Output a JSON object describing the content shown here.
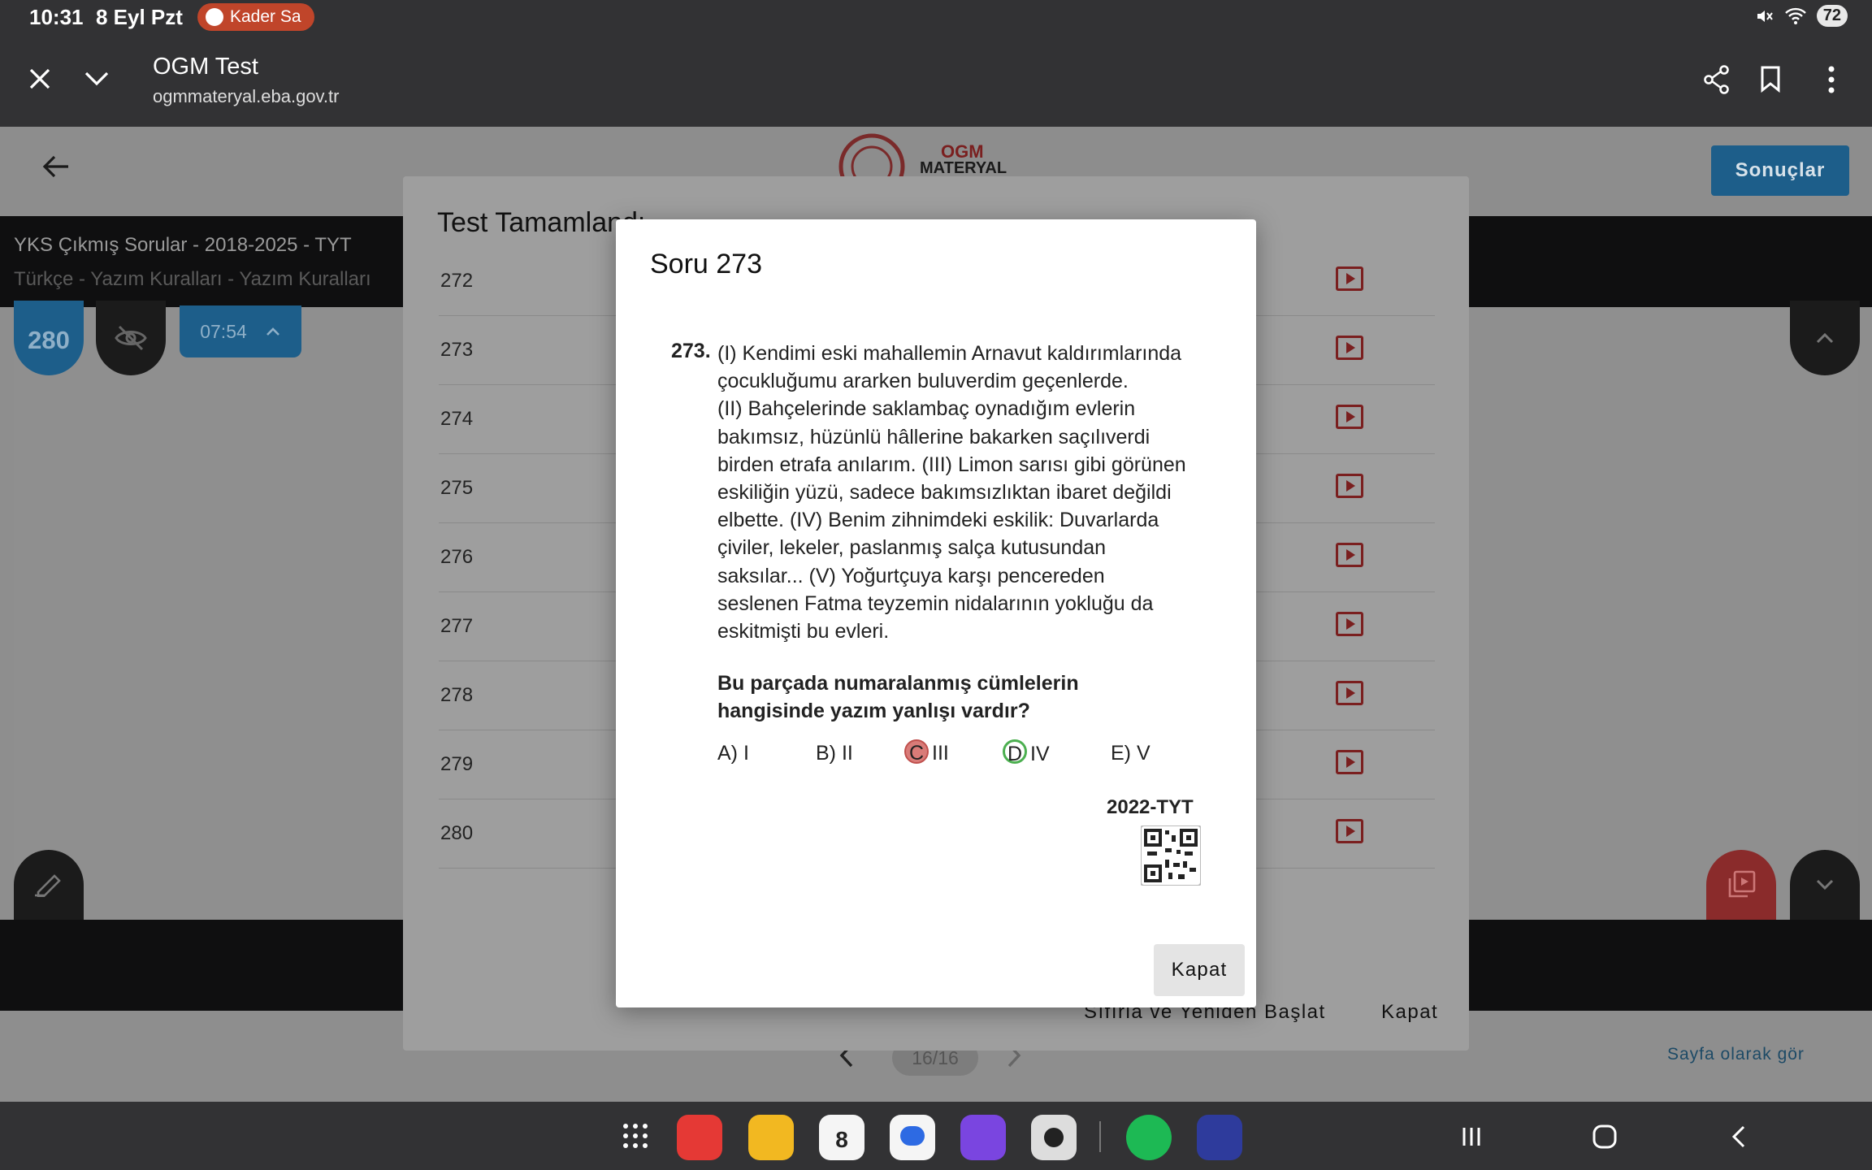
{
  "status": {
    "time": "10:31",
    "date": "8 Eyl Pzt",
    "media_chip": "Kader Sa",
    "battery": "72"
  },
  "browser": {
    "title": "OGM Test",
    "url": "ogmmateryal.eba.gov.tr"
  },
  "app": {
    "logo_text_1": "OGM",
    "logo_text_2": "MATERYAL",
    "results_button": "Sonuçlar",
    "breadcrumb_1": "YKS Çıkmış Sorular - 2018-2025 - TYT",
    "breadcrumb_2": "Türkçe - Yazım Kuralları - Yazım Kuralları",
    "question_badge": "280",
    "timer": "07:54",
    "pager_count": "16/16",
    "page_view_link": "Sayfa olarak gör"
  },
  "results_dialog": {
    "title": "Test Tamamlandı",
    "rows": [
      "272",
      "273",
      "274",
      "275",
      "276",
      "277",
      "278",
      "279",
      "280"
    ],
    "reset_button": "Sıfırla ve Yeniden Başlat",
    "close_button": "Kapat"
  },
  "question_modal": {
    "title": "Soru 273",
    "number": "273.",
    "passage": "(I) Kendimi eski mahallemin Arnavut kaldırımlarında\nçocukluğumu ararken buluverdim geçenlerde.\n(II) Bahçelerinde saklambaç oynadığım evlerin\nbakımsız, hüzünlü hâllerine bakarken saçılıverdi\nbirden etrafa anılarım. (III) Limon sarısı gibi görünen\neskiliğin yüzü, sadece bakımsızlıktan ibaret değildi\nelbette. (IV) Benim zihnimdeki eskilik: Duvarlarda\nçiviler, lekeler, paslanmış salça kutusundan\nsaksılar... (V) Yoğurtçuya karşı pencereden\nseslenen Fatma teyzemin nidalarının yokluğu da\neskitmişti bu evleri.",
    "stem": "Bu parçada numaralanmış cümlelerin\nhangisinde yazım yanlışı vardır?",
    "options": [
      {
        "letter": "A)",
        "text": "I"
      },
      {
        "letter": "B)",
        "text": "II"
      },
      {
        "letter": "C",
        "text": "III",
        "state": "wrong-selected"
      },
      {
        "letter": "D",
        "text": "IV",
        "state": "correct"
      },
      {
        "letter": "E)",
        "text": "V"
      }
    ],
    "source": "2022-TYT",
    "close_button": "Kapat"
  },
  "colors": {
    "accent_blue": "#1d5e8a",
    "wrong_red": "#d97b78",
    "correct_green": "#4caf50",
    "play_red": "#7a1f1f"
  }
}
